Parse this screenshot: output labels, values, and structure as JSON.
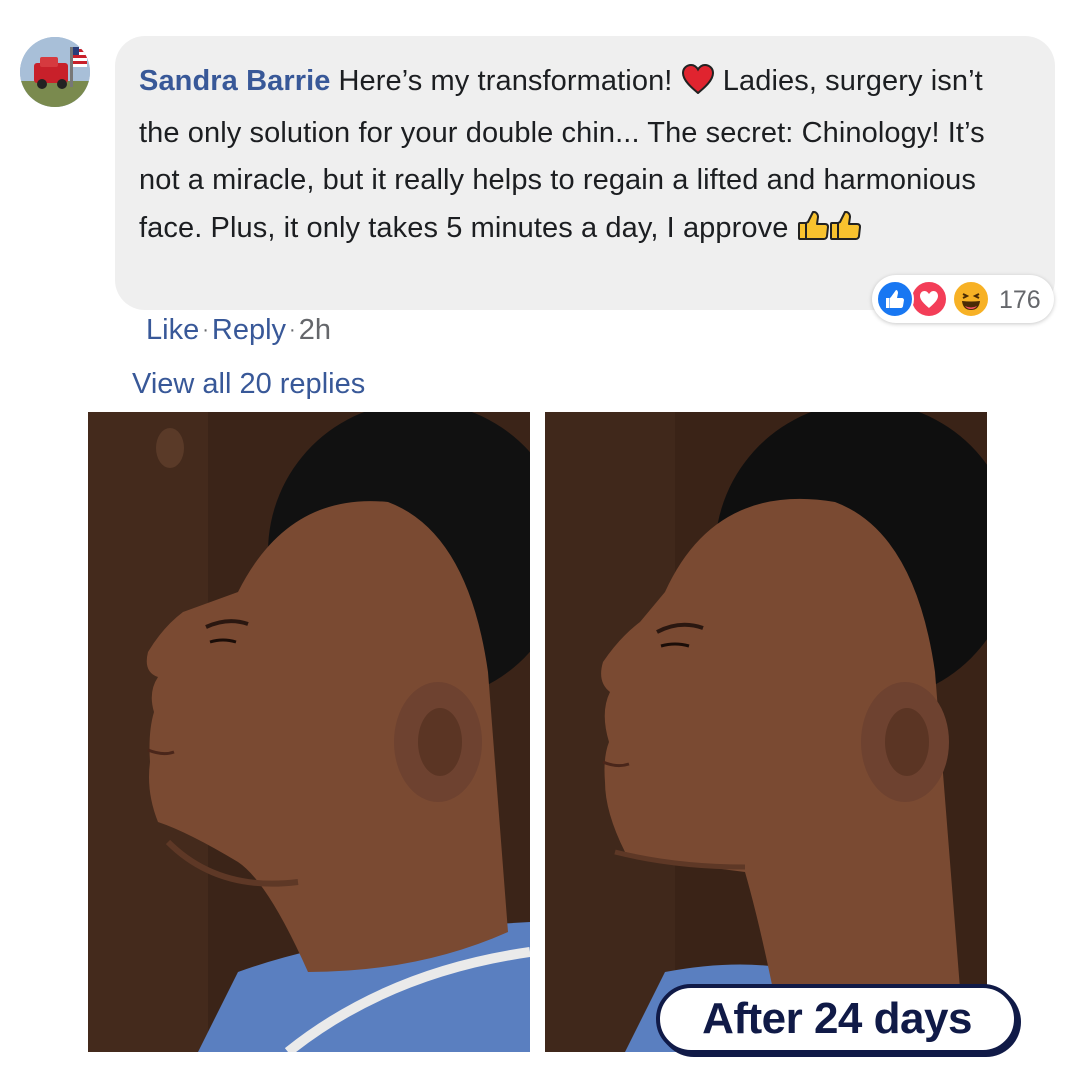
{
  "comment": {
    "author": "Sandra Barrie",
    "text_part1": "Here’s my transformation! ",
    "text_part2": " Ladies, surgery isn’t the only solution for your double chin... The secret: Chinology! It’s not a miracle, but it really helps to regain a lifted and harmonious face. Plus, it only takes 5 minutes a day, I approve ",
    "inline_icons": [
      "red-heart-icon",
      "thumbs-up-icon",
      "thumbs-up-icon"
    ],
    "reactions": {
      "icons": [
        "like-reaction-icon",
        "love-reaction-icon",
        "haha-reaction-icon"
      ],
      "count": "176"
    },
    "actions": {
      "like": "Like",
      "reply": "Reply",
      "separator": "·",
      "time": "2h"
    },
    "view_replies": "View all 20 replies"
  },
  "images": {
    "before": "profile photo of woman's chin and neck, before",
    "after": "profile photo of woman's chin and neck, after"
  },
  "after_badge": "After 24 days",
  "colors": {
    "author_blue": "#385898",
    "bubble_bg": "#efefef",
    "meta_grey": "#65676b",
    "badge_navy": "#101a47",
    "like_blue": "#1877f2",
    "love_red": "#f33e58",
    "haha_yellow": "#f7b125"
  }
}
